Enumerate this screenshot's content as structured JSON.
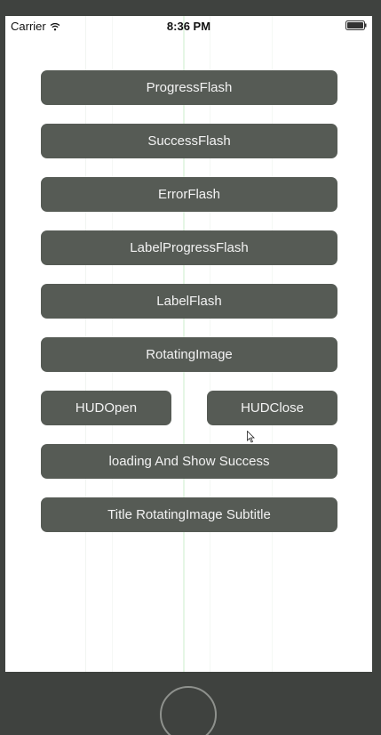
{
  "status_bar": {
    "carrier": "Carrier",
    "time": "8:36 PM",
    "wifi_icon": "wifi-icon",
    "battery_icon": "battery-icon"
  },
  "buttons": {
    "progress_flash": "ProgressFlash",
    "success_flash": "SuccessFlash",
    "error_flash": "ErrorFlash",
    "label_progress_flash": "LabelProgressFlash",
    "label_flash": "LabelFlash",
    "rotating_image": "RotatingImage",
    "hud_open": "HUDOpen",
    "hud_close": "HUDClose",
    "loading_and_show_success": "loading And Show Success",
    "title_rotating_image_subtitle": "Title RotatingImage Subtitle"
  },
  "colors": {
    "button_bg": "#565b55",
    "button_text": "#f2f2f2",
    "device_frame": "#3f423f",
    "screen_bg": "#ffffff"
  }
}
